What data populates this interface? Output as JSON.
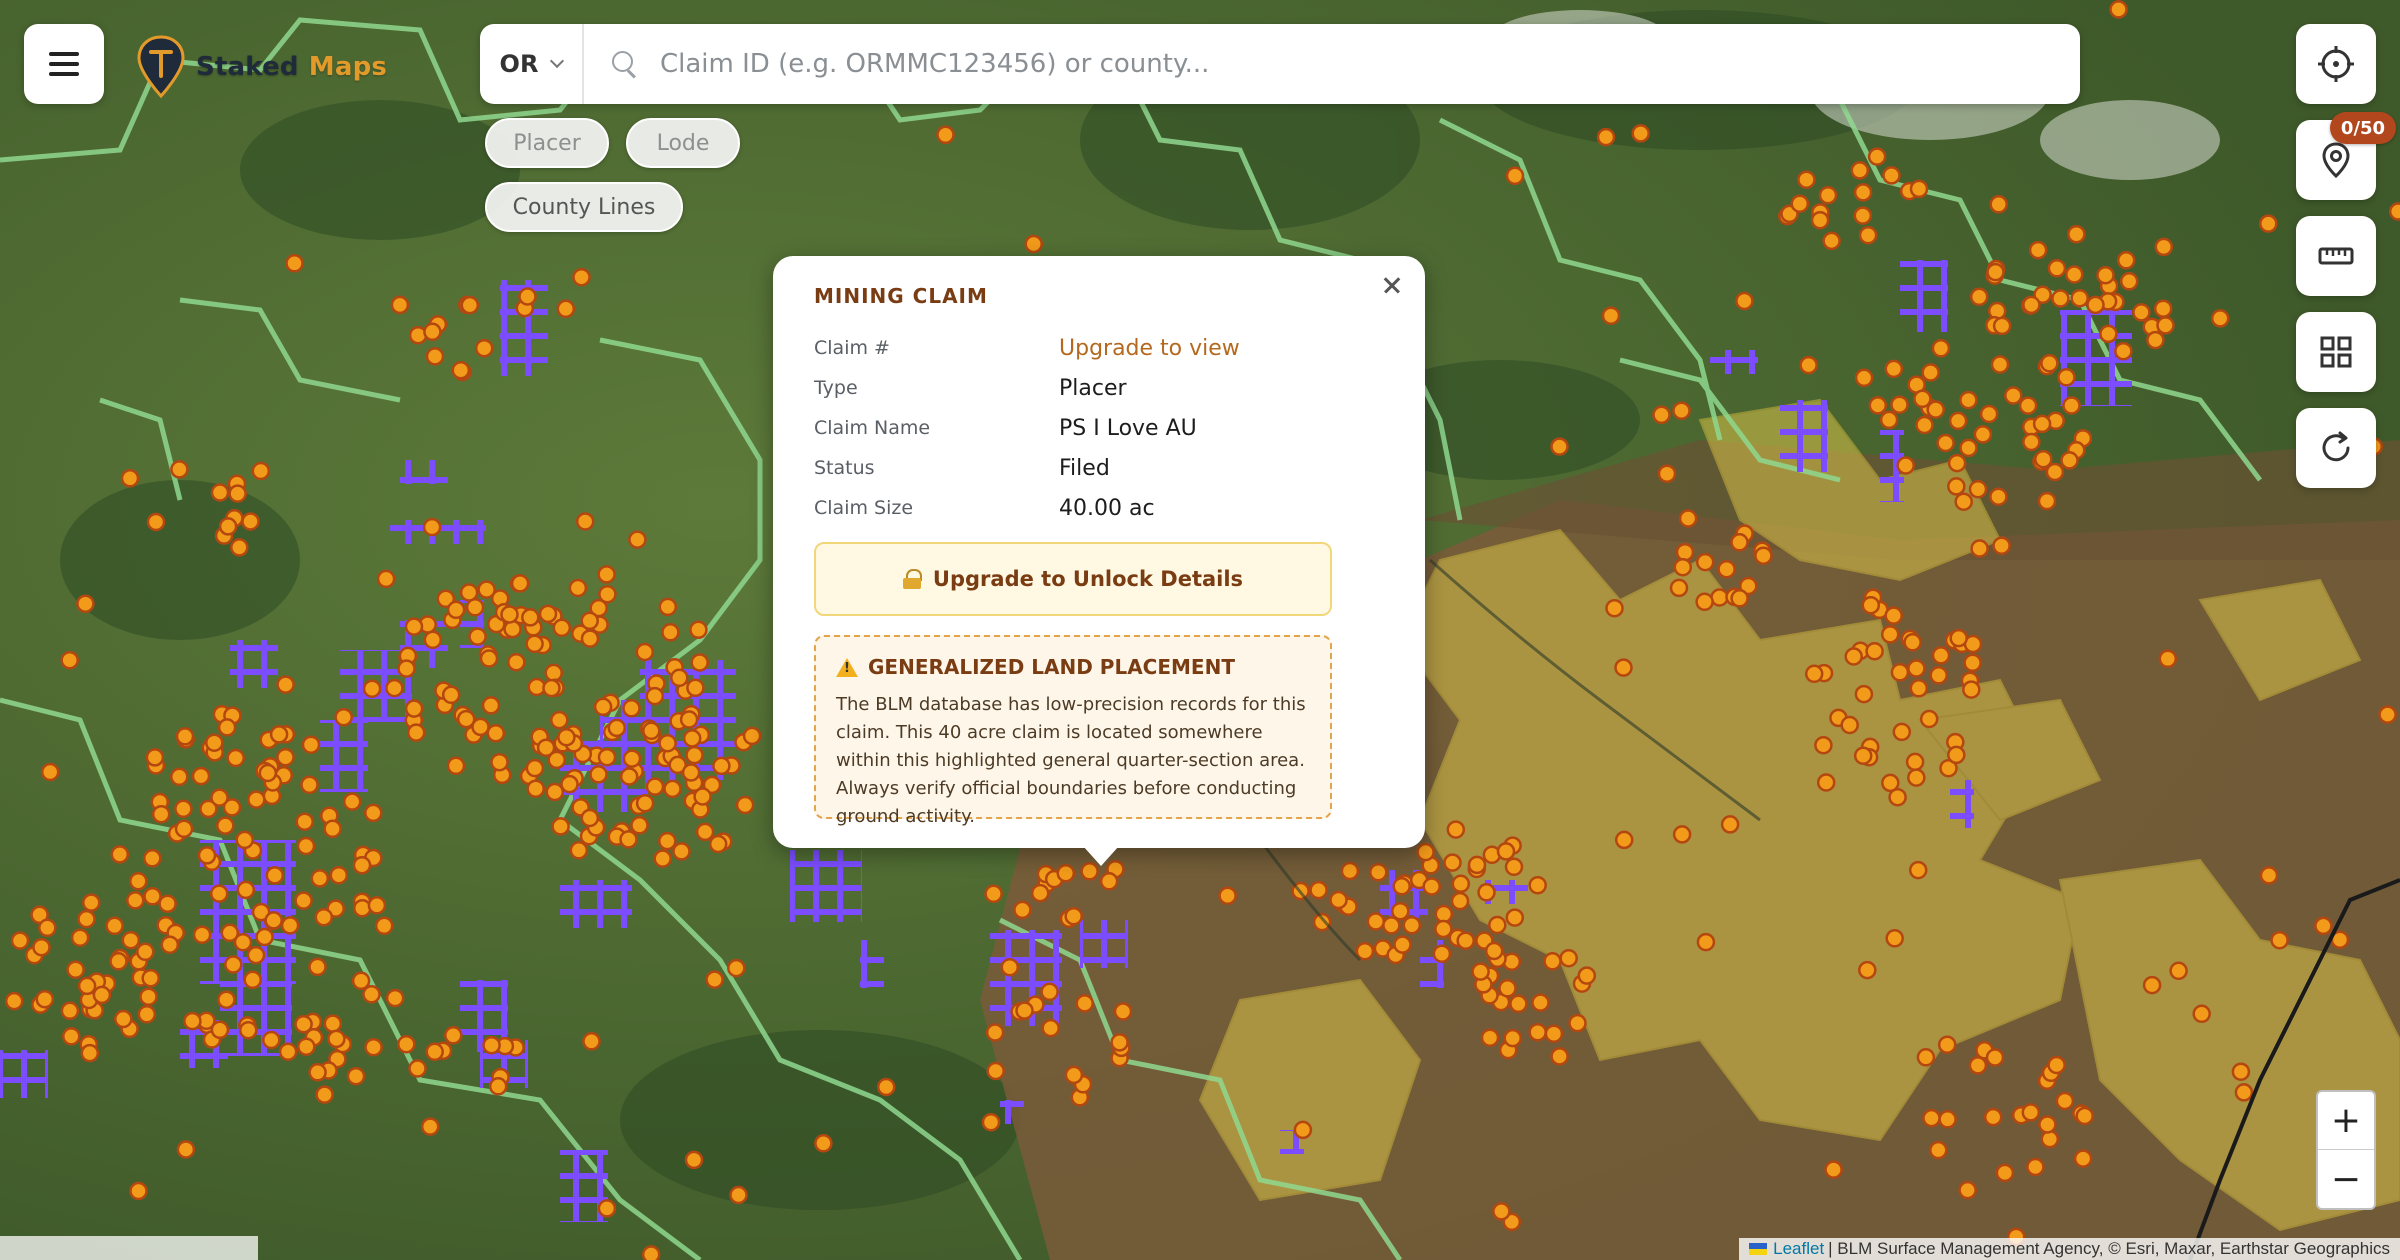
{
  "header": {
    "logo_word_1": "Staked",
    "logo_word_2": "Maps"
  },
  "search": {
    "state_value": "OR",
    "placeholder": "Claim ID (e.g. ORMMC123456) or county..."
  },
  "filters": {
    "placer_label": "Placer",
    "lode_label": "Lode",
    "county_lines_label": "County Lines"
  },
  "controls": {
    "saved_count_badge": "0/50",
    "icons": [
      "crosshair-icon",
      "map-pin-icon",
      "ruler-icon",
      "grid-icon",
      "refresh-icon"
    ],
    "zoom_in_label": "+",
    "zoom_out_label": "−"
  },
  "popup": {
    "title": "MINING CLAIM",
    "rows": [
      {
        "key": "Claim #",
        "value": "Upgrade to view"
      },
      {
        "key": "Type",
        "value": "Placer"
      },
      {
        "key": "Claim Name",
        "value": "PS I Love AU"
      },
      {
        "key": "Status",
        "value": "Filed"
      },
      {
        "key": "Claim Size",
        "value": "40.00 ac"
      }
    ],
    "unlock_label": "Upgrade to Unlock Details",
    "warning_title": "GENERALIZED LAND PLACEMENT",
    "warning_text": "The BLM database has low-precision records for this claim. This 40 acre claim is located somewhere within this highlighted general quarter-section area. Always verify official boundaries before conducting ground activity."
  },
  "attribution": {
    "leaflet": "Leaflet",
    "rest": "| BLM Surface Management Agency, © Esri, Maxar, Earthstar Geographics"
  },
  "colors": {
    "claim_dot": "#f29a1a",
    "claim_dot_stroke": "#b4470f",
    "claim_square": "#7b4dff",
    "blm_land": "#d9c24a",
    "forest_outline": "#8fd88f",
    "accent": "#7a3c12"
  }
}
